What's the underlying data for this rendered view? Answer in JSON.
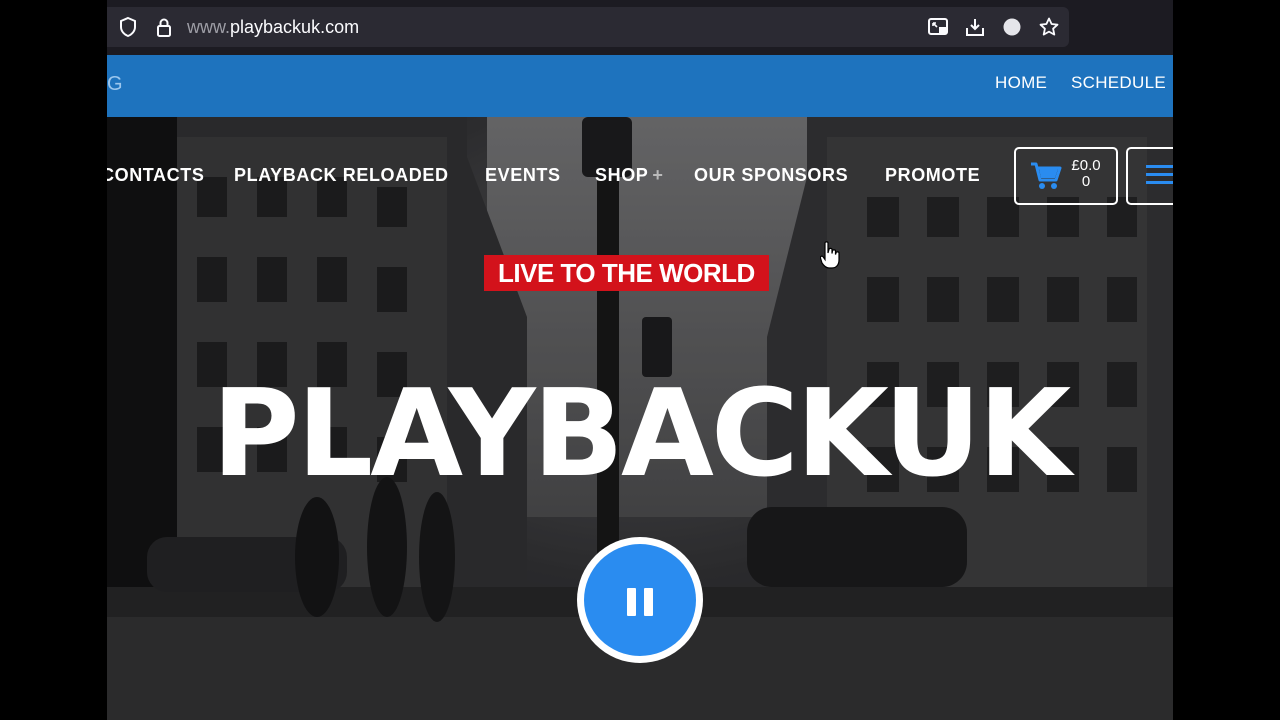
{
  "browser": {
    "url_prefix": "www.",
    "url_domain": "playbackuk.com"
  },
  "header": {
    "logo_fragment": "G",
    "nav": [
      "HOME",
      "SCHEDULE"
    ]
  },
  "main_nav": {
    "items": [
      "CONTACTS",
      "PLAYBACK RELOADED",
      "EVENTS",
      "SHOP",
      "OUR SPONSORS",
      "PROMOTE"
    ],
    "shop_plus": "+",
    "cart_price": "£0.00"
  },
  "hero": {
    "tagline": "LIVE TO THE WORLD",
    "title": "PLAYBACKUK",
    "player_state": "playing"
  },
  "colors": {
    "header_blue": "#1e73be",
    "tagline_red": "#d3121b",
    "play_button_blue": "#2a8cf0"
  }
}
